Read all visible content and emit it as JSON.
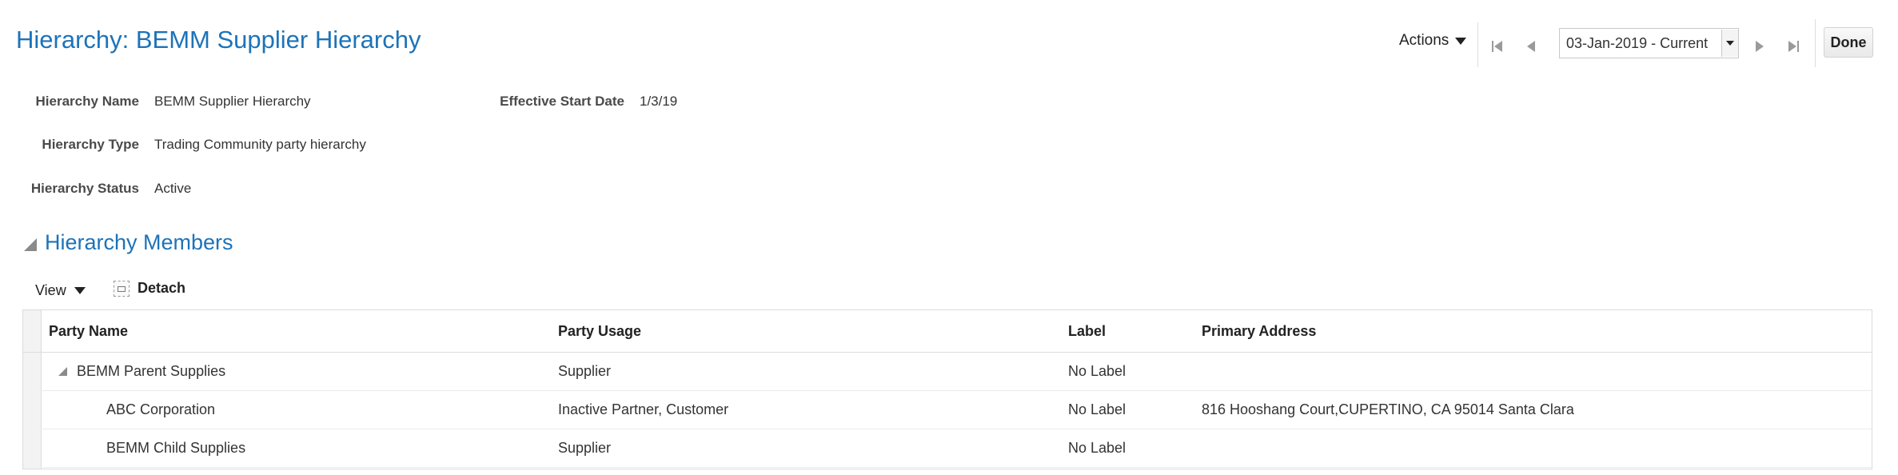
{
  "page": {
    "title": "Hierarchy: BEMM Supplier Hierarchy"
  },
  "header": {
    "actions_label": "Actions",
    "date_value": "03-Jan-2019 - Current",
    "done_label": "Done"
  },
  "fields": {
    "hierarchy_name_label": "Hierarchy Name",
    "hierarchy_name_value": "BEMM Supplier Hierarchy",
    "hierarchy_type_label": "Hierarchy Type",
    "hierarchy_type_value": "Trading Community party hierarchy",
    "hierarchy_status_label": "Hierarchy Status",
    "hierarchy_status_value": "Active",
    "effective_start_label": "Effective Start Date",
    "effective_start_value": "1/3/19"
  },
  "members": {
    "title": "Hierarchy Members",
    "view_label": "View",
    "detach_label": "Detach",
    "columns": [
      "Party Name",
      "Party Usage",
      "Label",
      "Primary Address"
    ],
    "rows": [
      {
        "name": "BEMM Parent Supplies",
        "usage": "Supplier",
        "label": "No Label",
        "address": ""
      },
      {
        "name": "ABC Corporation",
        "usage": "Inactive Partner, Customer",
        "label": "No Label",
        "address": "816 Hooshang Court,CUPERTINO, CA 95014 Santa Clara"
      },
      {
        "name": "BEMM Child Supplies",
        "usage": "Supplier",
        "label": "No Label",
        "address": ""
      }
    ]
  },
  "colors": {
    "accent": "#1d73b8",
    "border": "#dcdcdc"
  }
}
